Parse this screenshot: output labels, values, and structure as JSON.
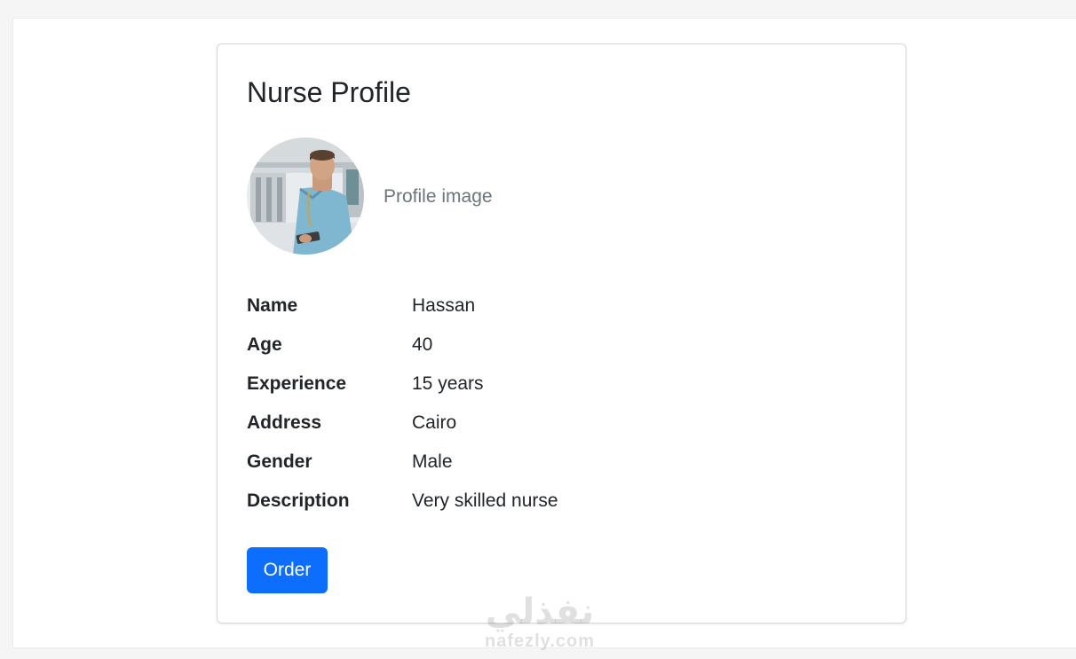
{
  "profile": {
    "title": "Nurse Profile",
    "image_caption": "Profile image",
    "fields": [
      {
        "label": "Name",
        "value": "Hassan"
      },
      {
        "label": "Age",
        "value": "40"
      },
      {
        "label": "Experience",
        "value": "15 years"
      },
      {
        "label": "Address",
        "value": "Cairo"
      },
      {
        "label": "Gender",
        "value": "Male"
      },
      {
        "label": "Description",
        "value": "Very skilled nurse"
      }
    ],
    "order_label": "Order"
  },
  "watermark": {
    "arabic": "نفذلي",
    "latin": "nafezly.com"
  },
  "colors": {
    "primary": "#0d6efd",
    "text": "#212529",
    "muted": "#6c757d",
    "border": "#d7d7d7"
  }
}
